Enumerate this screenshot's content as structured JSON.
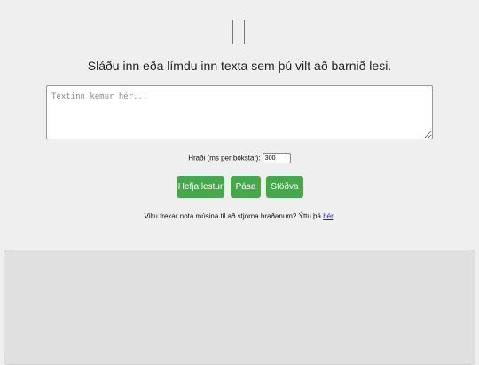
{
  "logo": {
    "icon": "placeholder-glyph-icon"
  },
  "headline": "Sláðu inn eða límdu inn texta sem þú vilt að barnið lesi.",
  "text_input": {
    "placeholder": "Textinn kemur hér...",
    "value": ""
  },
  "speed": {
    "label": "Hraði (ms per bókstaf):",
    "value": "300"
  },
  "buttons": {
    "start": "Hefja lestur",
    "pause": "Pása",
    "stop": "Stöðva"
  },
  "hint": {
    "text": "Viltu frekar nota músina til að stjórna hraðanum? Ýttu þá ",
    "link": "hér",
    "suffix": "."
  },
  "colors": {
    "button_green": "#45a84c",
    "link_blue": "#1a1aee",
    "background": "#efefef",
    "panel": "#e0e0e0"
  }
}
